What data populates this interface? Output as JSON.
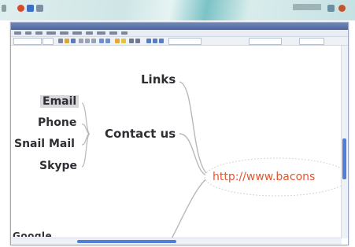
{
  "mindmap": {
    "links_label": "Links",
    "contact_label": "Contact us",
    "email_label": "Email",
    "phone_label": "Phone",
    "snail_mail_label": "Snail Mail",
    "skype_label": "Skype",
    "url_label": "http://www.bacons",
    "bottom_partial_label": "Google"
  },
  "colors": {
    "link_text": "#e0562d",
    "scroll_thumb": "#4f7fd6",
    "connector": "#b8b8bc"
  },
  "icons": {
    "tray": [
      "app-icon",
      "network-icon",
      "volume-icon",
      "battery-icon"
    ],
    "toolbar": [
      "new-icon",
      "open-icon",
      "save-icon",
      "cut-icon",
      "copy-icon",
      "paste-icon",
      "undo-icon",
      "redo-icon",
      "bold-icon",
      "italic-icon"
    ]
  }
}
